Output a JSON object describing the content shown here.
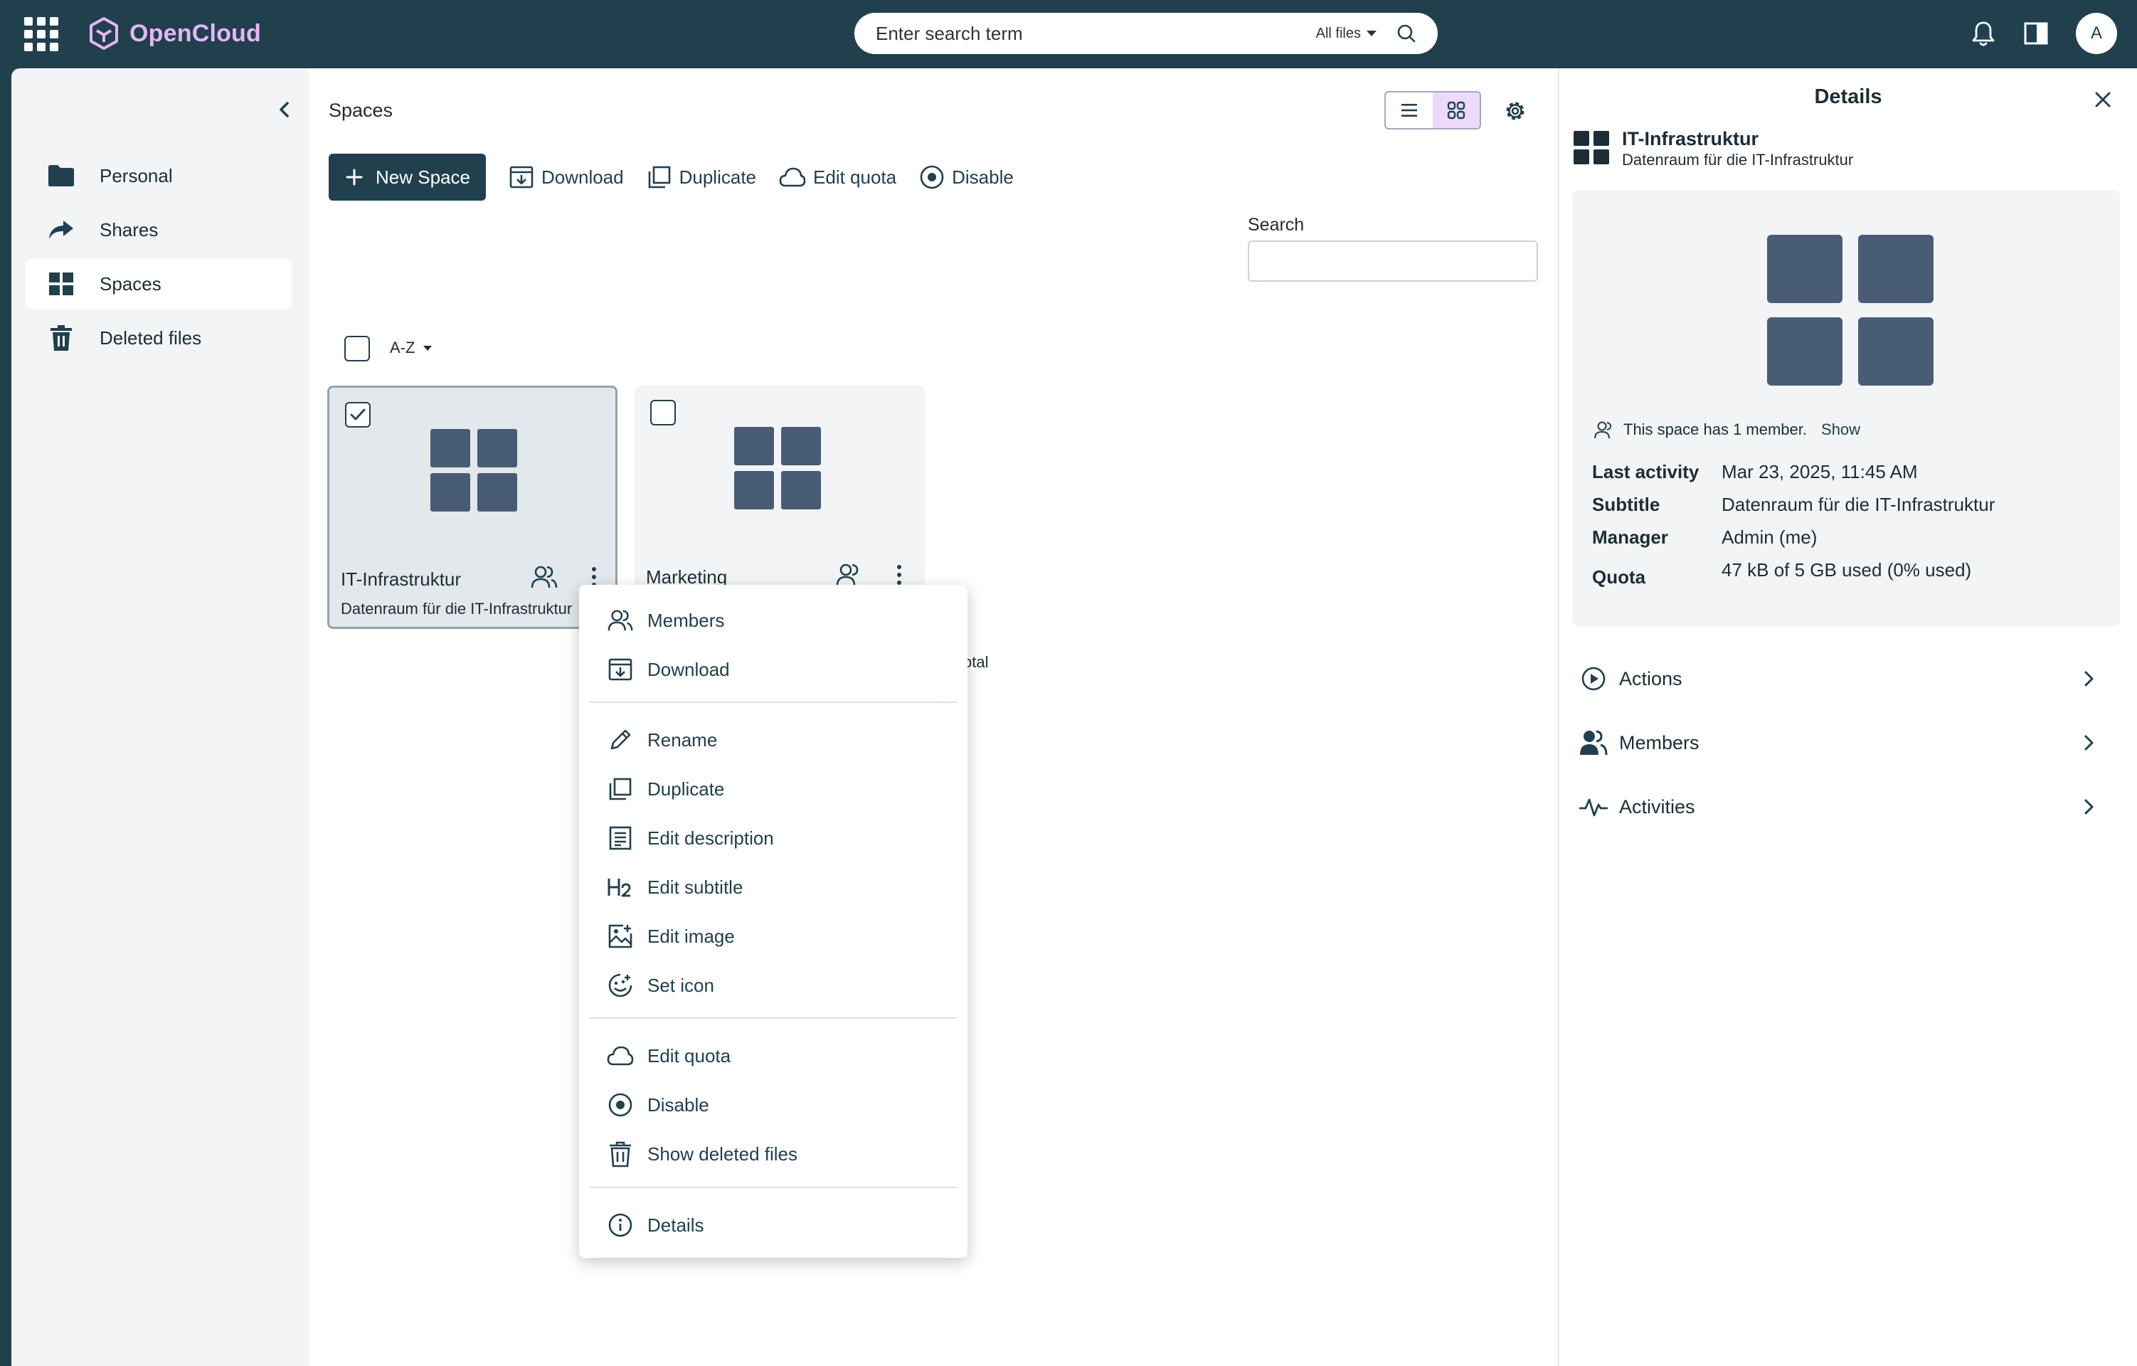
{
  "app": {
    "name": "OpenCloud"
  },
  "topbar": {
    "search_placeholder": "Enter search term",
    "search_scope": "All files",
    "avatar_initial": "A"
  },
  "sidebar": {
    "items": [
      {
        "label": "Personal",
        "icon": "folder-icon"
      },
      {
        "label": "Shares",
        "icon": "share-arrow-icon"
      },
      {
        "label": "Spaces",
        "icon": "spaces-grid-icon",
        "active": true
      },
      {
        "label": "Deleted files",
        "icon": "trash-icon"
      }
    ]
  },
  "main": {
    "breadcrumb": "Spaces",
    "toolbar": {
      "new_space": "New Space",
      "download": "Download",
      "duplicate": "Duplicate",
      "edit_quota": "Edit quota",
      "disable": "Disable"
    },
    "search_label": "Search",
    "search_value": "",
    "sort_label": "A-Z",
    "cards": [
      {
        "title": "IT-Infrastruktur",
        "subtitle": "Datenraum für die IT-Infrastruktur",
        "selected": true
      },
      {
        "title": "Marketing",
        "subtitle": "",
        "selected": false
      }
    ],
    "total_fragment": "otal"
  },
  "context_menu": {
    "groups": [
      [
        {
          "label": "Members",
          "icon": "members-icon"
        },
        {
          "label": "Download",
          "icon": "download-icon"
        }
      ],
      [
        {
          "label": "Rename",
          "icon": "pencil-icon"
        },
        {
          "label": "Duplicate",
          "icon": "duplicate-icon"
        },
        {
          "label": "Edit description",
          "icon": "description-icon"
        },
        {
          "label": "Edit subtitle",
          "icon": "heading-icon"
        },
        {
          "label": "Edit image",
          "icon": "image-edit-icon"
        },
        {
          "label": "Set icon",
          "icon": "emoji-icon"
        }
      ],
      [
        {
          "label": "Edit quota",
          "icon": "cloud-icon"
        },
        {
          "label": "Disable",
          "icon": "stop-circle-icon"
        },
        {
          "label": "Show deleted files",
          "icon": "trash-icon"
        }
      ],
      [
        {
          "label": "Details",
          "icon": "info-icon"
        }
      ]
    ]
  },
  "details": {
    "title": "Details",
    "space_name": "IT-Infrastruktur",
    "space_subtitle": "Datenraum für die IT-Infrastruktur",
    "member_text": "This space has 1 member.",
    "member_show": "Show",
    "props": [
      {
        "key": "Last activity",
        "value": "Mar 23, 2025, 11:45 AM"
      },
      {
        "key": "Subtitle",
        "value": "Datenraum für die IT-Infrastruktur"
      },
      {
        "key": "Manager",
        "value": "Admin (me)"
      },
      {
        "key": "Quota",
        "value": "47 kB of 5 GB used (0% used)"
      }
    ],
    "sections": [
      {
        "label": "Actions",
        "icon": "play-circle-icon"
      },
      {
        "label": "Members",
        "icon": "members-filled-icon"
      },
      {
        "label": "Activities",
        "icon": "activity-icon"
      }
    ]
  },
  "colors": {
    "topbar": "#20404e",
    "brand": "#e7b5f2",
    "thumbnail": "#485d75",
    "selected_toggle": "#ecd9fb"
  }
}
